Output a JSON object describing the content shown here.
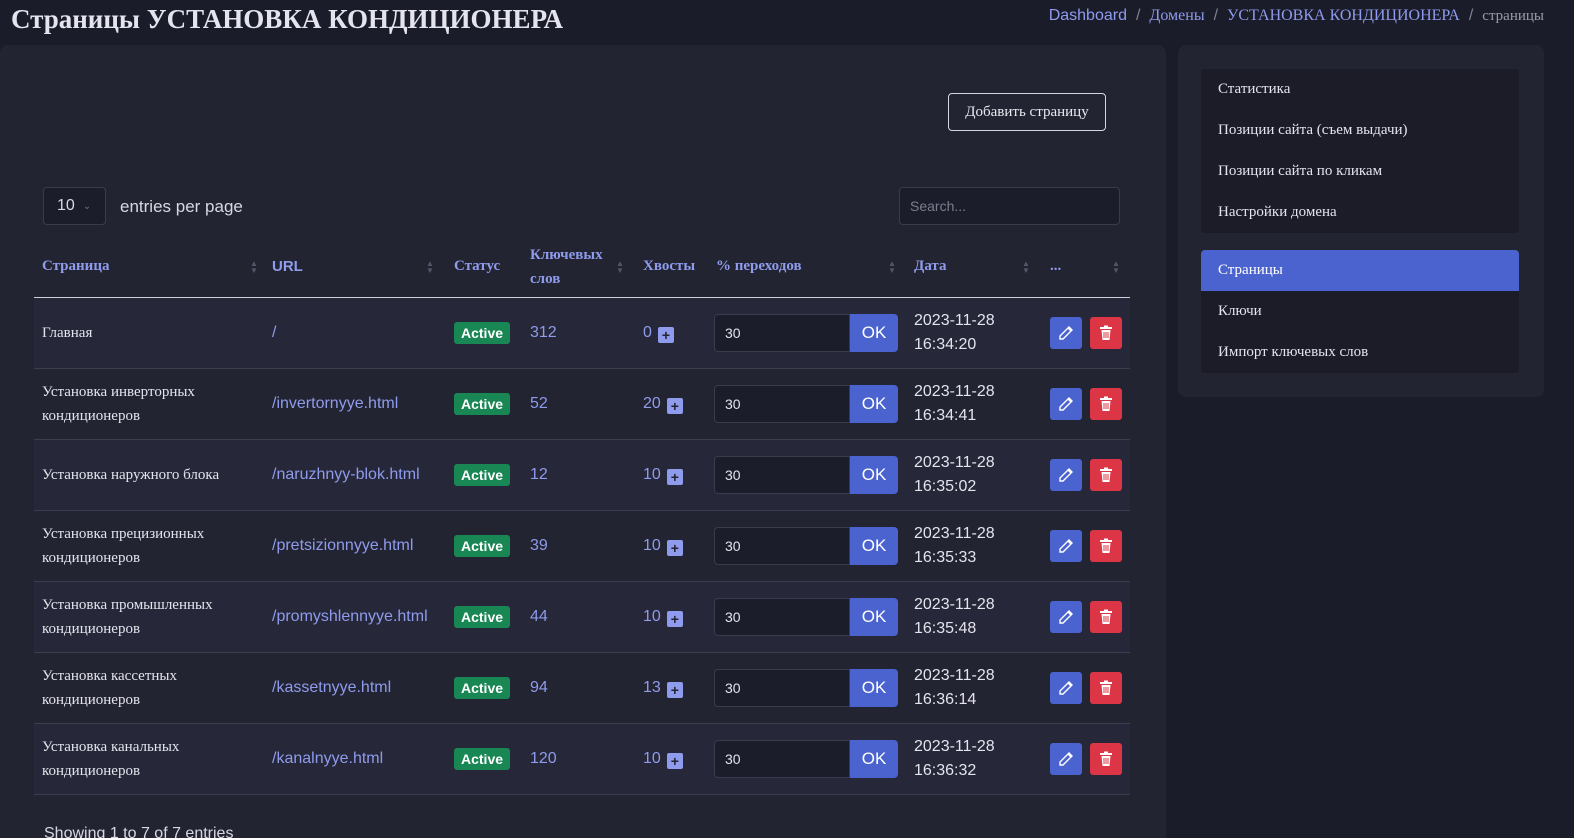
{
  "header": {
    "title": "Страницы УСТАНОВКА КОНДИЦИОНЕРА",
    "breadcrumb": [
      "Dashboard",
      "Домены",
      "УСТАНОВКА КОНДИЦИОНЕРА",
      "страницы"
    ]
  },
  "toolbar": {
    "add_page_label": "Добавить страницу",
    "per_page_value": "10",
    "per_page_label": "entries per page",
    "search_placeholder": "Search..."
  },
  "table": {
    "columns": [
      "Страница",
      "URL",
      "Статус",
      "Ключевых слов",
      "Хвосты",
      "% переходов",
      "Дата",
      "..."
    ],
    "rows": [
      {
        "page": "Главная",
        "url": "/",
        "status": "Active",
        "keys": "312",
        "tails": "0",
        "pct": "30",
        "date": "2023-11-28",
        "time": "16:34:20"
      },
      {
        "page": "Установка инверторных кондиционеров",
        "url": "/invertornyye.html",
        "status": "Active",
        "keys": "52",
        "tails": "20",
        "pct": "30",
        "date": "2023-11-28",
        "time": "16:34:41"
      },
      {
        "page": "Установка наружного блока",
        "url": "/naruzhnyy-blok.html",
        "status": "Active",
        "keys": "12",
        "tails": "10",
        "pct": "30",
        "date": "2023-11-28",
        "time": "16:35:02"
      },
      {
        "page": "Установка прецизионных кондиционеров",
        "url": "/pretsizionnyye.html",
        "status": "Active",
        "keys": "39",
        "tails": "10",
        "pct": "30",
        "date": "2023-11-28",
        "time": "16:35:33"
      },
      {
        "page": "Установка промышленных кондиционеров",
        "url": "/promyshlennyye.html",
        "status": "Active",
        "keys": "44",
        "tails": "10",
        "pct": "30",
        "date": "2023-11-28",
        "time": "16:35:48"
      },
      {
        "page": "Установка кассетных кондиционеров",
        "url": "/kassetnyye.html",
        "status": "Active",
        "keys": "94",
        "tails": "13",
        "pct": "30",
        "date": "2023-11-28",
        "time": "16:36:14"
      },
      {
        "page": "Установка канальных кондиционеров",
        "url": "/kanalnyye.html",
        "status": "Active",
        "keys": "120",
        "tails": "10",
        "pct": "30",
        "date": "2023-11-28",
        "time": "16:36:32"
      }
    ],
    "ok_label": "OK",
    "footer": "Showing 1 to 7 of 7 entries"
  },
  "sidebar": {
    "group1": [
      "Статистика",
      "Позиции сайта (съем выдачи)",
      "Позиции сайта по кликам",
      "Настройки домена"
    ],
    "group2": [
      "Страницы",
      "Ключи",
      "Импорт ключевых слов"
    ],
    "active": "Страницы"
  },
  "colors": {
    "accent": "#4a63cf",
    "link": "#8f9bec",
    "success": "#198754",
    "danger": "#dc3545"
  }
}
